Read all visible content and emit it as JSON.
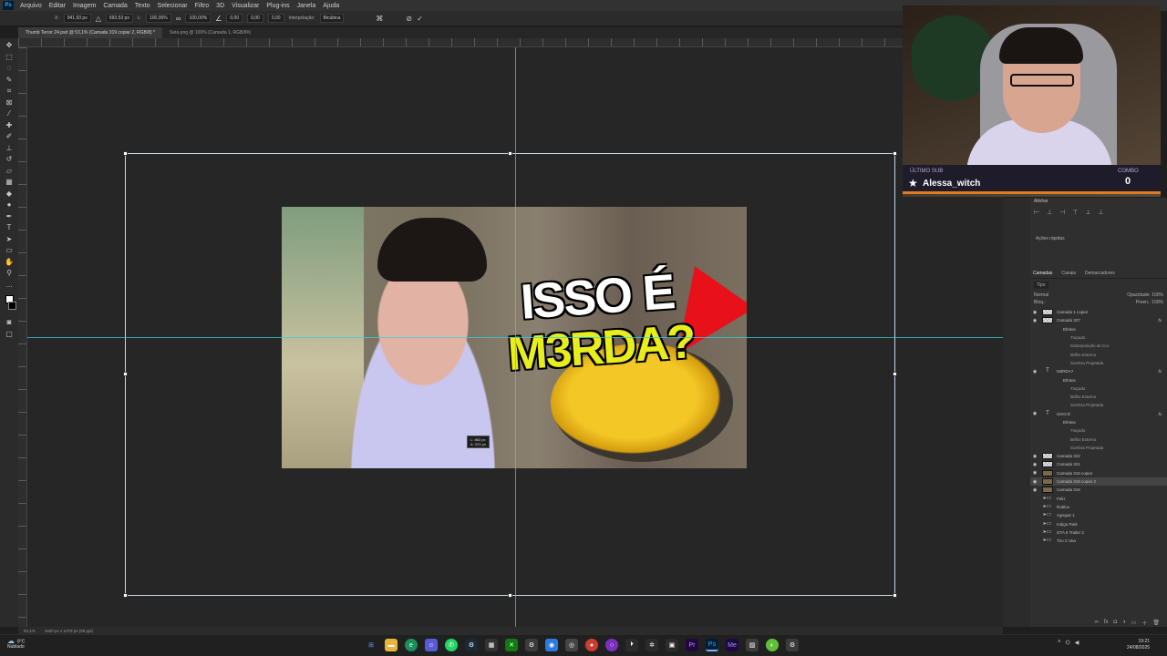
{
  "app": {
    "logo": "Ps",
    "menu": [
      "Arquivo",
      "Editar",
      "Imagem",
      "Camada",
      "Texto",
      "Selecionar",
      "Filtro",
      "3D",
      "Visualizar",
      "Plug-ins",
      "Janela",
      "Ajuda"
    ]
  },
  "options": {
    "x_label": "X:",
    "x_value": "941,93 px",
    "y_value": "693,53 px",
    "w_label": "L:",
    "w_value": "100,00%",
    "h_value": "100,00%",
    "angle_value": "0,00",
    "hskew_value": "0,00",
    "vskew_value": "0,00",
    "interp_label": "Interpolação:",
    "interp_value": "Bicúbica"
  },
  "tabs": [
    {
      "label": "Thumb Terror 24.psd @ 53,1% (Camada 319 copiar 2, RGB/8) *"
    },
    {
      "label": "Seta.png @ 100% (Camada 1, RGB/8#)"
    }
  ],
  "thumbnail": {
    "line1": "ISSO É",
    "line2": "M3RDA?"
  },
  "size_tooltip": {
    "w": "L: 863 px",
    "h": "A: 221 px"
  },
  "status": {
    "zoom": "53,1%",
    "doc_size": "1920 px x 1079 px (96 ppi)"
  },
  "webcam": {
    "sub_label": "ÚLTIMO SUB",
    "sub_name": "Alessa_witch",
    "combo_label": "COMBO",
    "combo_value": "0"
  },
  "panels": {
    "align_label": "Alinhar",
    "quick_actions": "Ações rápidas",
    "layers_tabs": [
      "Camadas",
      "Canais",
      "Demarcadores"
    ],
    "filter_type": "Tipo",
    "blend_mode": "Normal",
    "opacity_label": "Opacidade:",
    "opacity_value": "100%",
    "lock_label": "Bloq.:",
    "fill_label": "Preen.:",
    "fill_value": "100%"
  },
  "layers": [
    {
      "name": "Camada 1 copiar",
      "kind": "layer"
    },
    {
      "name": "Camada 327",
      "kind": "layer",
      "fx": true
    },
    {
      "name": "Efeitos",
      "kind": "effects"
    },
    {
      "name": "Traçado",
      "kind": "effect"
    },
    {
      "name": "Sobreposição de Cor",
      "kind": "effect"
    },
    {
      "name": "Brilho Externo",
      "kind": "effect"
    },
    {
      "name": "Sombra Projetada",
      "kind": "effect"
    },
    {
      "name": "M3RDA?",
      "kind": "text",
      "fx": true
    },
    {
      "name": "Efeitos",
      "kind": "effects"
    },
    {
      "name": "Traçado",
      "kind": "effect"
    },
    {
      "name": "Brilho Externo",
      "kind": "effect"
    },
    {
      "name": "Sombra Projetada",
      "kind": "effect"
    },
    {
      "name": "ISSO É",
      "kind": "text",
      "fx": true
    },
    {
      "name": "Efeitos",
      "kind": "effects"
    },
    {
      "name": "Traçado",
      "kind": "effect"
    },
    {
      "name": "Brilho Externo",
      "kind": "effect"
    },
    {
      "name": "Sombra Projetada",
      "kind": "effect"
    },
    {
      "name": "Camada 322",
      "kind": "layer"
    },
    {
      "name": "Camada 321",
      "kind": "layer"
    },
    {
      "name": "Camada 319 copiar",
      "kind": "image"
    },
    {
      "name": "Camada 319 copiar 2",
      "kind": "image",
      "selected": true
    },
    {
      "name": "Camada 319",
      "kind": "image"
    },
    {
      "name": "Feliz",
      "kind": "folder"
    },
    {
      "name": "Roblox",
      "kind": "folder"
    },
    {
      "name": "Agrupar 1",
      "kind": "folder"
    },
    {
      "name": "Indigo Park",
      "kind": "folder"
    },
    {
      "name": "GTA 6 Trailer 2",
      "kind": "folder"
    },
    {
      "name": "Tiro 2 Una",
      "kind": "folder"
    }
  ],
  "taskbar": {
    "temp": "8°C",
    "condition": "Nublado",
    "time": "19:21",
    "date": "24/08/2025"
  },
  "colors": {
    "guide": "#34d0e0",
    "accent_orange": "#e07b23",
    "title_yellow": "#e8ee1c",
    "arrow_red": "#e8111a"
  }
}
